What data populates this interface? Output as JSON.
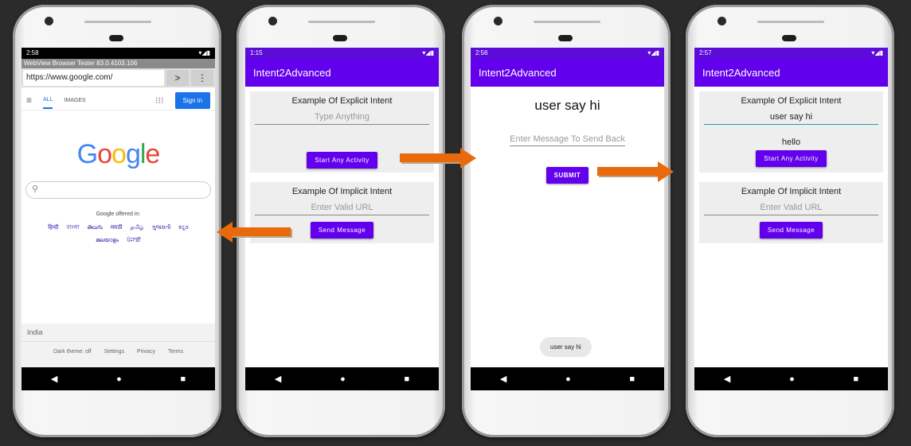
{
  "phone1": {
    "status_time": "2:58",
    "status_icons": "▾◢▮",
    "webview_title": "WebView Browser Tester 83.0.4103.106",
    "url_value": "https://www.google.com/",
    "go_icon": "chevron-right-icon",
    "menu_icon": "more-vert-icon",
    "tab_all": "ALL",
    "tab_images": "IMAGES",
    "signin_label": "Sign in",
    "logo_letters": [
      "G",
      "o",
      "o",
      "g",
      "l",
      "e"
    ],
    "logo_colors": [
      "#4285f4",
      "#ea4335",
      "#fbbc05",
      "#4285f4",
      "#34a853",
      "#ea4335"
    ],
    "offered_in": "Google offered in:",
    "languages": [
      "हिन्दी",
      "বাংলা",
      "తెలుగు",
      "मराठी",
      "தமிழ்",
      "ગુજરાતી",
      "ಕನ್ನಡ",
      "മലയാളം",
      "ਪੰਜਾਬੀ"
    ],
    "country": "India",
    "footer_links": [
      "Dark theme: off",
      "Settings",
      "Privacy",
      "Terms"
    ]
  },
  "phone2": {
    "status_time": "1:15",
    "status_icons": "▾◢▮",
    "app_title": "Intent2Advanced",
    "explicit_title": "Example Of Explicit Intent",
    "explicit_placeholder": "Type Anything",
    "start_button": "Start Any Activity",
    "implicit_title": "Example Of Implicit Intent",
    "implicit_placeholder": "Enter Valid URL",
    "send_button": "Send Message"
  },
  "phone3": {
    "status_time": "2:56",
    "status_icons": "▾◢▮",
    "app_title": "Intent2Advanced",
    "heading": "user say hi",
    "reply_placeholder": "Enter Message To Send Back",
    "submit_button": "SUBMIT",
    "toast": "user say hi"
  },
  "phone4": {
    "status_time": "2:57",
    "status_icons": "▾◢▮",
    "app_title": "Intent2Advanced",
    "explicit_title": "Example Of Explicit Intent",
    "explicit_value": "user say hi",
    "reply_text": "hello",
    "start_button": "Start Any Activity",
    "implicit_title": "Example Of Implicit Intent",
    "implicit_placeholder": "Enter Valid URL",
    "send_button": "Send Message"
  },
  "nav": {
    "back": "◀",
    "home": "●",
    "recents": "■"
  },
  "colors": {
    "accent": "#6200ee",
    "arrow": "#e86a0d",
    "google_blue": "#1a73e8"
  }
}
